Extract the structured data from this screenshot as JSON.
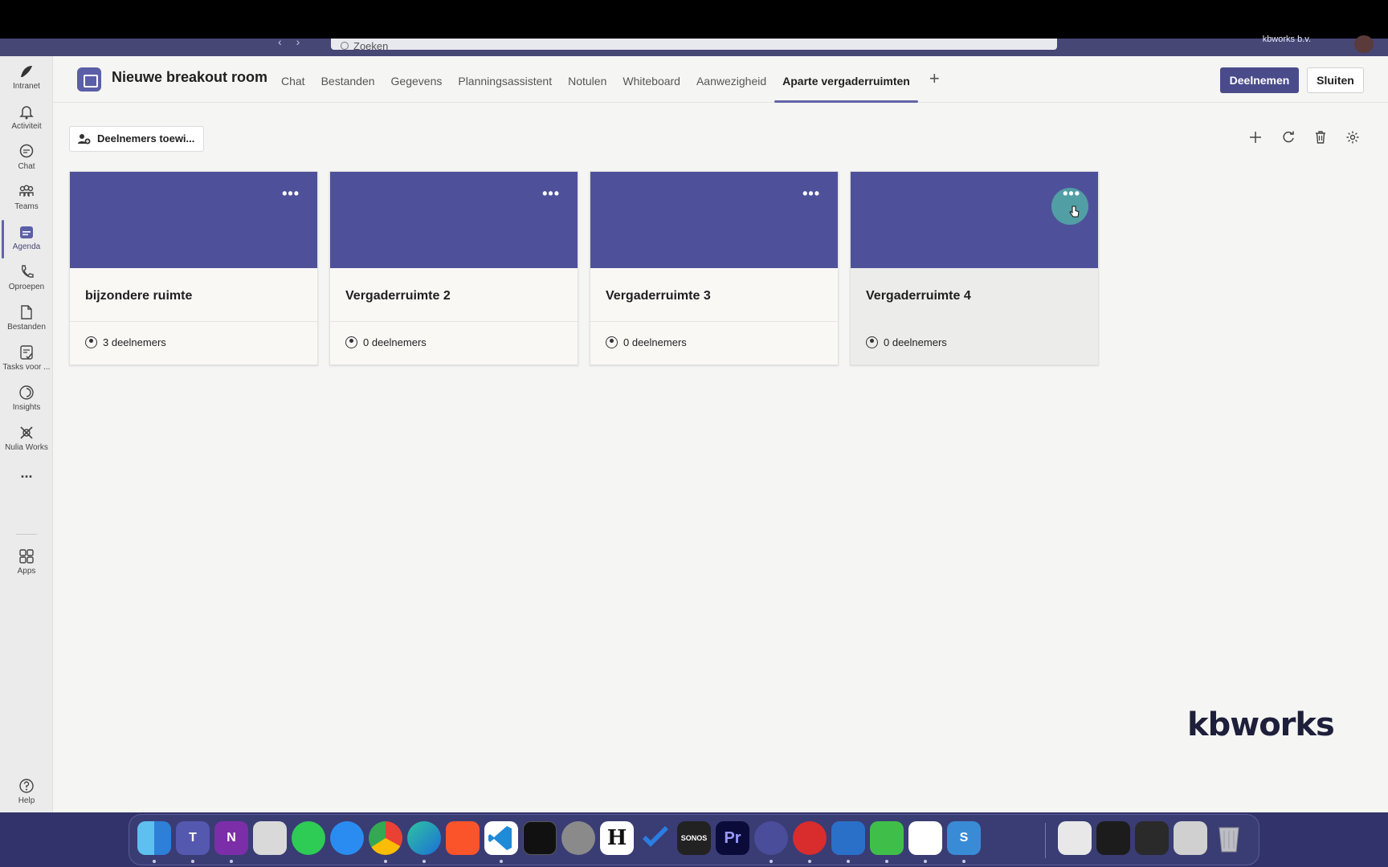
{
  "titlebar": {
    "search_placeholder": "Zoeken",
    "org_name": "kbworks b.v."
  },
  "rail": {
    "items": [
      {
        "label": "Intranet",
        "icon": "intranet-icon"
      },
      {
        "label": "Activiteit",
        "icon": "bell-icon"
      },
      {
        "label": "Chat",
        "icon": "chat-icon"
      },
      {
        "label": "Teams",
        "icon": "teams-icon"
      },
      {
        "label": "Agenda",
        "icon": "calendar-icon"
      },
      {
        "label": "Oproepen",
        "icon": "phone-icon"
      },
      {
        "label": "Bestanden",
        "icon": "file-icon"
      },
      {
        "label": "Tasks voor ...",
        "icon": "tasks-icon"
      },
      {
        "label": "Insights",
        "icon": "insights-icon"
      },
      {
        "label": "Nulia Works",
        "icon": "nulia-icon"
      },
      {
        "label": "Apps",
        "icon": "apps-icon"
      },
      {
        "label": "Help",
        "icon": "help-icon"
      }
    ],
    "more_label": "..."
  },
  "header": {
    "title": "Nieuwe breakout room",
    "tabs": [
      {
        "label": "Chat"
      },
      {
        "label": "Bestanden"
      },
      {
        "label": "Gegevens"
      },
      {
        "label": "Planningsassistent"
      },
      {
        "label": "Notulen"
      },
      {
        "label": "Whiteboard"
      },
      {
        "label": "Aanwezigheid"
      },
      {
        "label": "Aparte vergaderruimten"
      }
    ],
    "add_tab": "+",
    "join_label": "Deelnemen",
    "close_label": "Sluiten"
  },
  "toolbar": {
    "assign_label": "Deelnemers toewi..."
  },
  "rooms": [
    {
      "name": "bijzondere ruimte",
      "participants": "3 deelnemers"
    },
    {
      "name": "Vergaderruimte 2",
      "participants": "0 deelnemers"
    },
    {
      "name": "Vergaderruimte 3",
      "participants": "0 deelnemers"
    },
    {
      "name": "Vergaderruimte 4",
      "participants": "0 deelnemers"
    }
  ],
  "card_more": "•••",
  "logo": "kbworks",
  "colors": {
    "brand": "#4e519a",
    "accent": "#6264a7",
    "hover": "#52a7a6"
  },
  "dock": {
    "hemingway_label": "H",
    "sonos_label": "SONOS",
    "premiere_label": "Pr"
  }
}
